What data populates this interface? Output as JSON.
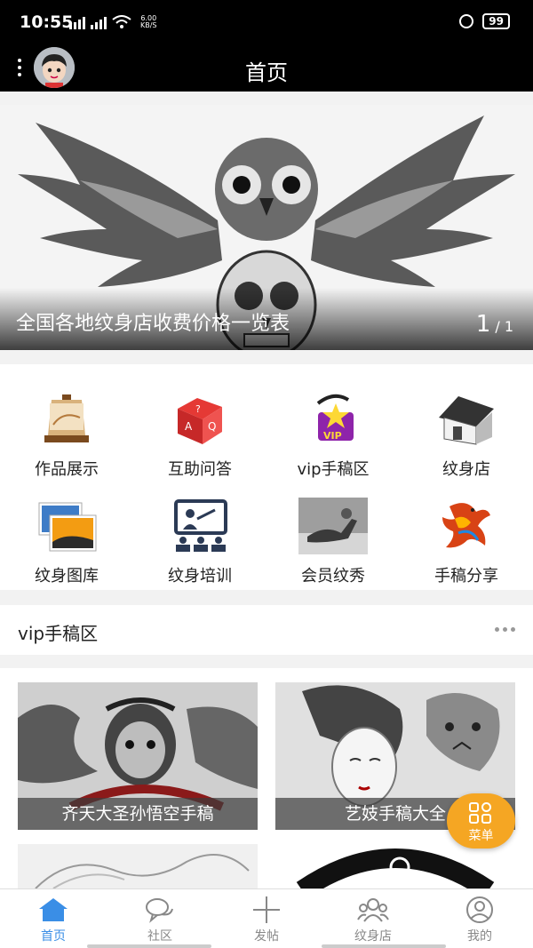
{
  "status_bar": {
    "time": "10:55",
    "net_speed": "6.00",
    "net_unit": "KB/S",
    "battery": "99"
  },
  "header": {
    "title": "首页",
    "avatar_icon": "user-avatar-icon",
    "menu_icon": "more-vertical-icon"
  },
  "banner": {
    "caption": "全国各地纹身店收费价格一览表",
    "page_current": "1",
    "page_sep": "/",
    "page_total": "1"
  },
  "grid": [
    {
      "label": "作品展示",
      "icon": "easel-icon"
    },
    {
      "label": "互助问答",
      "icon": "faq-cube-icon"
    },
    {
      "label": "vip手稿区",
      "icon": "vip-star-icon"
    },
    {
      "label": "纹身店",
      "icon": "house-icon"
    },
    {
      "label": "纹身图库",
      "icon": "photo-gallery-icon"
    },
    {
      "label": "纹身培训",
      "icon": "training-board-icon"
    },
    {
      "label": "会员纹秀",
      "icon": "member-photo-icon"
    },
    {
      "label": "手稿分享",
      "icon": "phoenix-drawing-icon"
    }
  ],
  "vip_section": {
    "title": "vip手稿区"
  },
  "cards": [
    {
      "caption": "齐天大圣孙悟空手稿"
    },
    {
      "caption": "艺妓手稿大全"
    }
  ],
  "fab": {
    "label": "菜单"
  },
  "tabbar": [
    {
      "label": "首页",
      "icon": "home-icon",
      "active": true
    },
    {
      "label": "社区",
      "icon": "chat-bubbles-icon",
      "active": false
    },
    {
      "label": "发帖",
      "icon": "plus-icon",
      "active": false
    },
    {
      "label": "纹身店",
      "icon": "people-group-icon",
      "active": false
    },
    {
      "label": "我的",
      "icon": "profile-icon",
      "active": false
    }
  ],
  "colors": {
    "accent": "#3a8ee6",
    "fab": "#f5a623",
    "header_bg": "#000000"
  }
}
